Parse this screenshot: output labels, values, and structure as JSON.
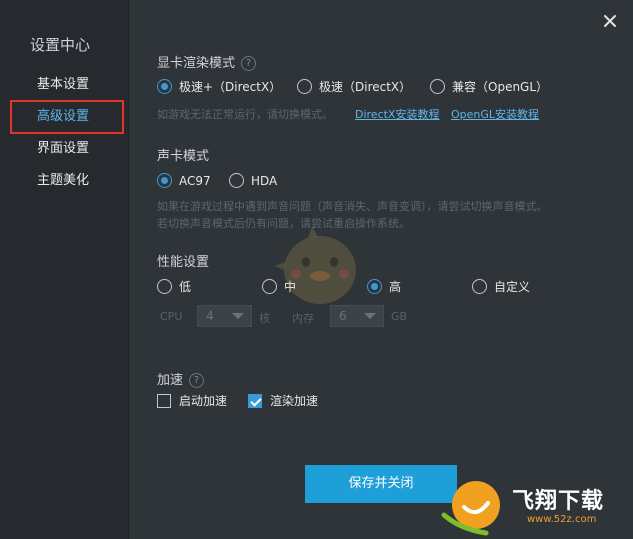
{
  "sidebar": {
    "title": "设置中心",
    "items": [
      {
        "label": "基本设置"
      },
      {
        "label": "高级设置"
      },
      {
        "label": "界面设置"
      },
      {
        "label": "主题美化"
      }
    ]
  },
  "render_mode": {
    "title": "显卡渲染模式",
    "options": [
      {
        "label": "极速+（DirectX）",
        "selected": true
      },
      {
        "label": "极速（DirectX）",
        "selected": false
      },
      {
        "label": "兼容（OpenGL）",
        "selected": false
      }
    ],
    "hint": "如游戏无法正常运行，请切换模式。",
    "link_directx": "DirectX安装教程",
    "link_opengl": "OpenGL安装教程"
  },
  "sound_mode": {
    "title": "声卡模式",
    "options": [
      {
        "label": "AC97",
        "selected": true
      },
      {
        "label": "HDA",
        "selected": false
      }
    ],
    "hint_line1": "如果在游戏过程中遇到声音问题（声音消失、声音变调），请尝试切换声音模式。",
    "hint_line2": "若切换声音模式后仍有问题，请尝试重启操作系统。"
  },
  "performance": {
    "title": "性能设置",
    "options": [
      {
        "label": "低",
        "selected": false
      },
      {
        "label": "中",
        "selected": false
      },
      {
        "label": "高",
        "selected": true
      },
      {
        "label": "自定义",
        "selected": false
      }
    ],
    "cpu_label": "CPU",
    "cpu_value": "4",
    "cpu_unit": "核",
    "mem_label": "内存",
    "mem_value": "6",
    "mem_unit": "GB"
  },
  "acceleration": {
    "title": "加速",
    "options": [
      {
        "label": "启动加速",
        "checked": false
      },
      {
        "label": "渲染加速",
        "checked": true
      }
    ]
  },
  "buttons": {
    "save_close": "保存并关闭"
  },
  "watermark": {
    "brand": "飞翔下载",
    "url": "www.52z.com"
  },
  "colors": {
    "accent": "#1e9fd8",
    "highlight_border": "#e0352d",
    "active_text": "#5fb4e8"
  }
}
